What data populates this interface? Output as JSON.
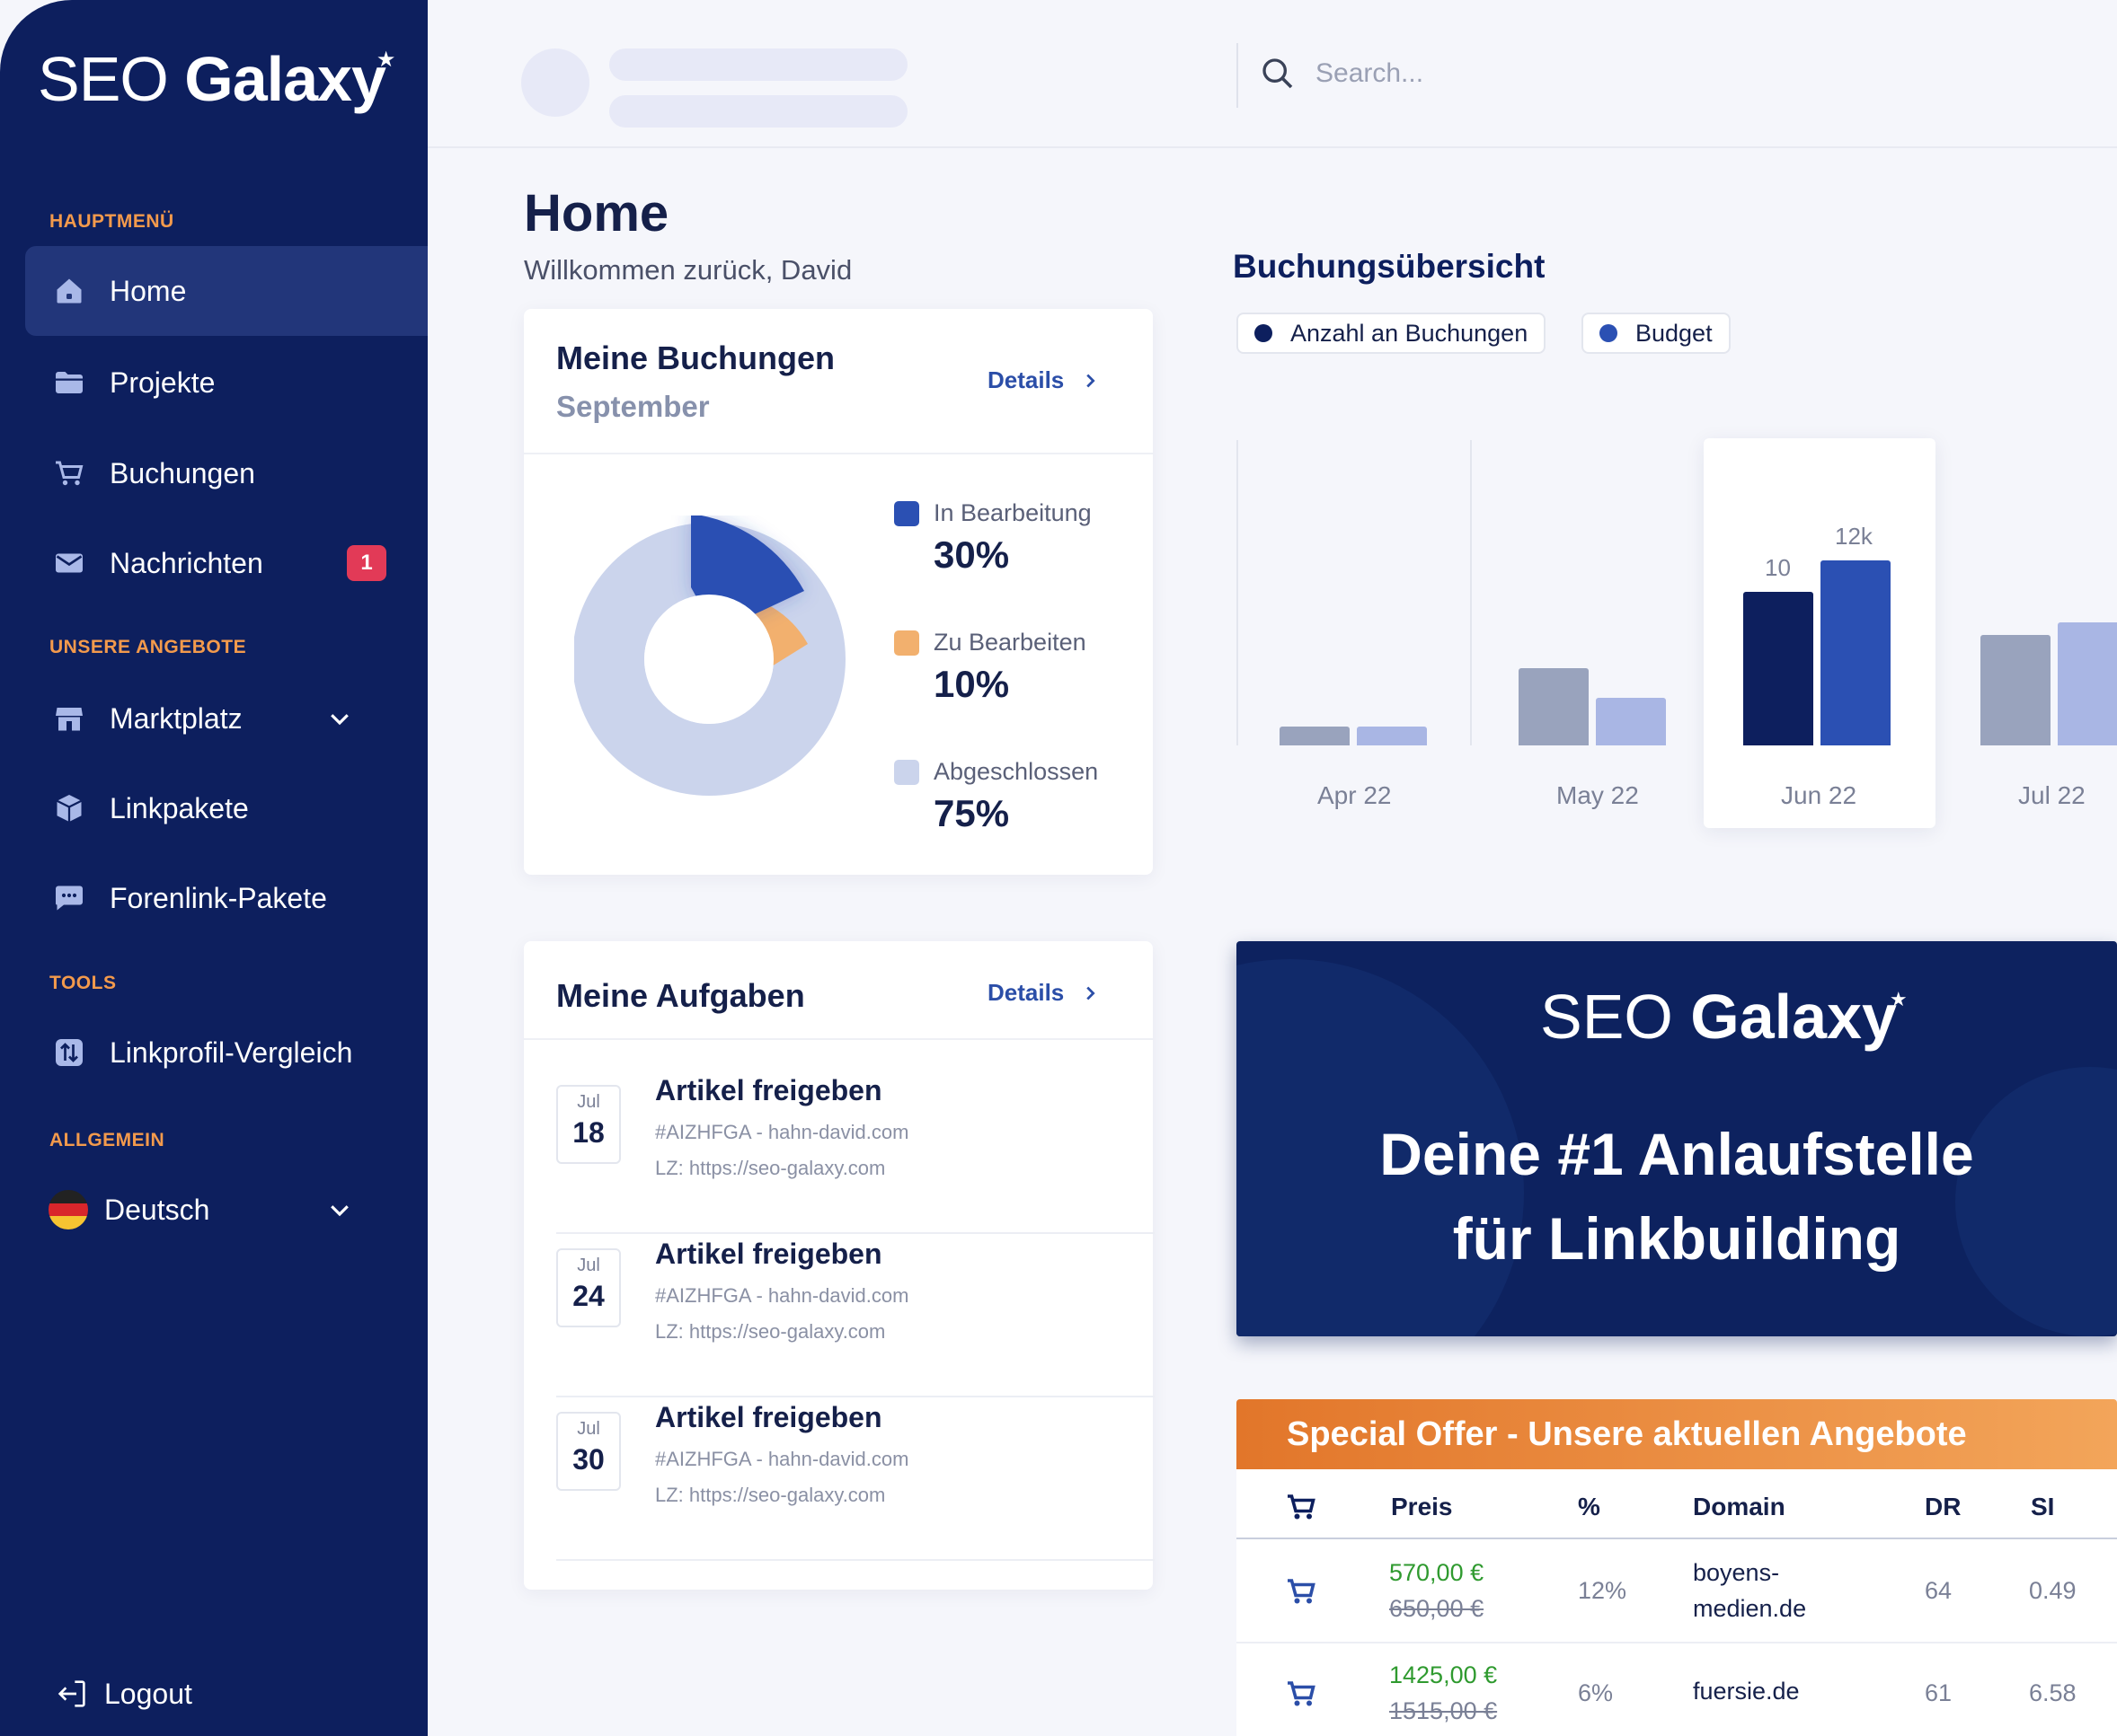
{
  "brand": {
    "logo_thin": "SEO",
    "logo_bold": "Galaxy"
  },
  "sidebar": {
    "sections": {
      "main": "HAUPTMENÜ",
      "offers": "UNSERE ANGEBOTE",
      "tools": "TOOLS",
      "general": "ALLGEMEIN"
    },
    "items": [
      {
        "label": "Home",
        "icon": "home-icon",
        "active": true
      },
      {
        "label": "Projekte",
        "icon": "folder-icon"
      },
      {
        "label": "Buchungen",
        "icon": "cart-icon"
      },
      {
        "label": "Nachrichten",
        "icon": "mail-icon",
        "badge": "1"
      },
      {
        "label": "Marktplatz",
        "icon": "store-icon"
      },
      {
        "label": "Linkpakete",
        "icon": "package-icon"
      },
      {
        "label": "Forenlink-Pakete",
        "icon": "chat-icon"
      },
      {
        "label": "Linkprofil-Vergleich",
        "icon": "compare-icon"
      },
      {
        "label": "Deutsch",
        "icon": "germany-flag-icon"
      }
    ],
    "logout": "Logout"
  },
  "topbar": {
    "search_placeholder": "Search..."
  },
  "page": {
    "title": "Home",
    "welcome": "Willkommen zurück, David"
  },
  "bookings_card": {
    "title": "Meine Buchungen",
    "month": "September",
    "details": "Details",
    "legend": [
      {
        "label": "In Bearbeitung",
        "value": "30%",
        "color": "#2b50b3"
      },
      {
        "label": "Zu Bearbeiten",
        "value": "10%",
        "color": "#f2b06e"
      },
      {
        "label": "Abgeschlossen",
        "value": "75%",
        "color": "#cbd4ec"
      }
    ]
  },
  "tasks_card": {
    "title": "Meine Aufgaben",
    "details": "Details",
    "tasks": [
      {
        "month": "Jul",
        "day": "18",
        "title": "Artikel freigeben",
        "meta": "#AIZHFGA - hahn-david.com",
        "lz": "LZ: https://seo-galaxy.com"
      },
      {
        "month": "Jul",
        "day": "24",
        "title": "Artikel freigeben",
        "meta": "#AIZHFGA - hahn-david.com",
        "lz": "LZ: https://seo-galaxy.com"
      },
      {
        "month": "Jul",
        "day": "30",
        "title": "Artikel freigeben",
        "meta": "#AIZHFGA - hahn-david.com",
        "lz": "LZ: https://seo-galaxy.com"
      }
    ]
  },
  "overview": {
    "title": "Buchungsübersicht",
    "legend_bookings": "Anzahl an Buchungen",
    "legend_budget": "Budget",
    "colors": {
      "bookings": "#0d1f5e",
      "budget": "#2b50b3",
      "bookings_muted": "#99a3bd",
      "budget_muted": "#a9b6e4"
    }
  },
  "chart_data": {
    "type": "bar",
    "categories": [
      "Apr 22",
      "May 22",
      "Jun 22",
      "Jul 22"
    ],
    "series": [
      {
        "name": "Anzahl an Buchungen",
        "values": [
          1.2,
          5,
          10,
          7.2
        ]
      },
      {
        "name": "Budget",
        "values": [
          1.2,
          3.1,
          12,
          8
        ]
      }
    ],
    "highlight_category": "Jun 22",
    "data_labels": {
      "Jun 22": [
        "10",
        "12k"
      ]
    },
    "ylim": [
      0,
      14
    ],
    "grid": false,
    "legend": "top-left"
  },
  "promo": {
    "headline_1": "Deine #1 Anlaufstelle",
    "headline_2": "für Linkbuilding"
  },
  "offers": {
    "title": "Special Offer - Unsere aktuellen Angebote",
    "columns": [
      "Preis",
      "%",
      "Domain",
      "DR",
      "SI"
    ],
    "rows": [
      {
        "price_new": "570,00 €",
        "price_old": "650,00 €",
        "percent": "12%",
        "domain_1": "boyens-",
        "domain_2": "medien.de",
        "dr": "64",
        "si": "0.49"
      },
      {
        "price_new": "1425,00 €",
        "price_old": "1515,00 €",
        "percent": "6%",
        "domain_1": "fuersie.de",
        "domain_2": "",
        "dr": "61",
        "si": "6.58"
      }
    ]
  }
}
